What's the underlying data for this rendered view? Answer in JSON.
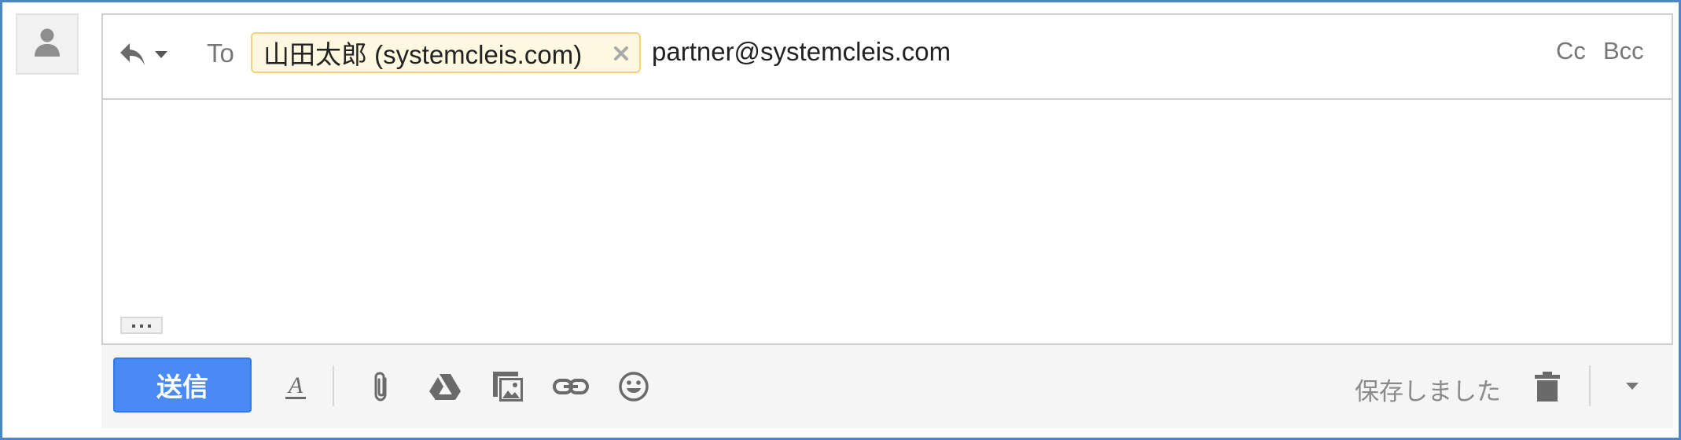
{
  "header": {
    "to_label": "To",
    "recipient_chip": "山田太郎 (systemcleis.com)",
    "recipient_input": "partner@systemcleis.com",
    "cc_label": "Cc",
    "bcc_label": "Bcc"
  },
  "toolbar": {
    "send_label": "送信",
    "saved_status": "保存しました"
  },
  "icons": {
    "avatar": "person-icon",
    "reply": "reply-icon",
    "remove_recipient": "close-icon",
    "more": "ellipsis-icon",
    "formatting": "text-format-icon",
    "attach": "paperclip-icon",
    "drive": "drive-icon",
    "photo": "photo-icon",
    "link": "link-icon",
    "emoji": "emoji-icon",
    "discard": "trash-icon",
    "more_options": "dropdown-arrow-icon"
  },
  "colors": {
    "send_button": "#4a8af4",
    "chip_border": "#f3d27a",
    "frame_border": "#4a86c8"
  }
}
